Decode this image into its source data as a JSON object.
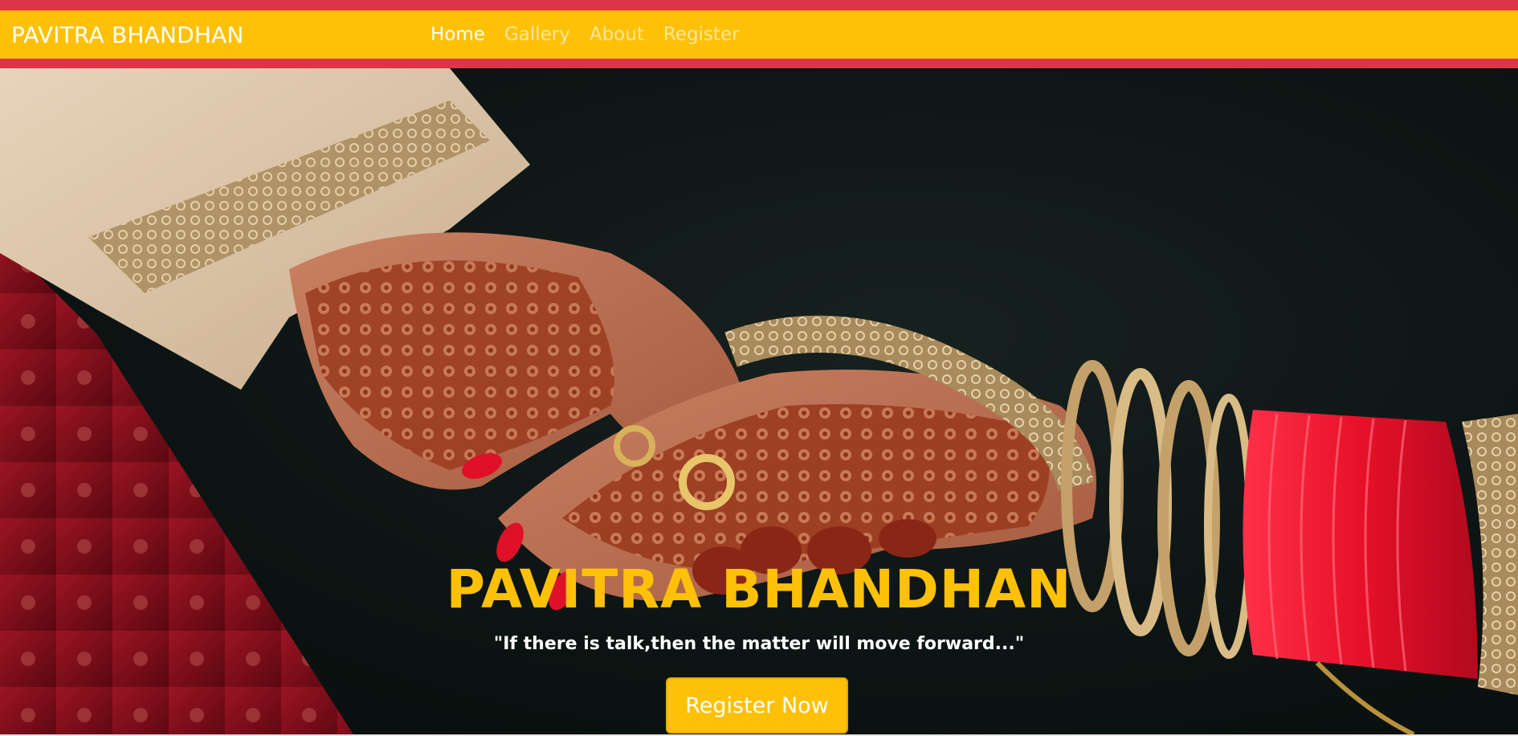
{
  "navbar": {
    "brand": "PAVITRA BHANDHAN",
    "links": [
      {
        "label": "Home",
        "active": true
      },
      {
        "label": "Gallery",
        "active": false
      },
      {
        "label": "About",
        "active": false
      },
      {
        "label": "Register",
        "active": false
      }
    ]
  },
  "hero": {
    "title": "PAVITRA BHANDHAN",
    "quote": "\"If there is talk,then the matter will move forward...\"",
    "button_label": "Register Now",
    "image_subject": "wedding-hands-with-mehndi-and-bangles"
  },
  "colors": {
    "accent_red": "#dc3545",
    "accent_yellow": "#ffc107",
    "hero_background": "#0c1413",
    "bangle_red": "#e8102a",
    "mehndi": "#8b2a14"
  }
}
